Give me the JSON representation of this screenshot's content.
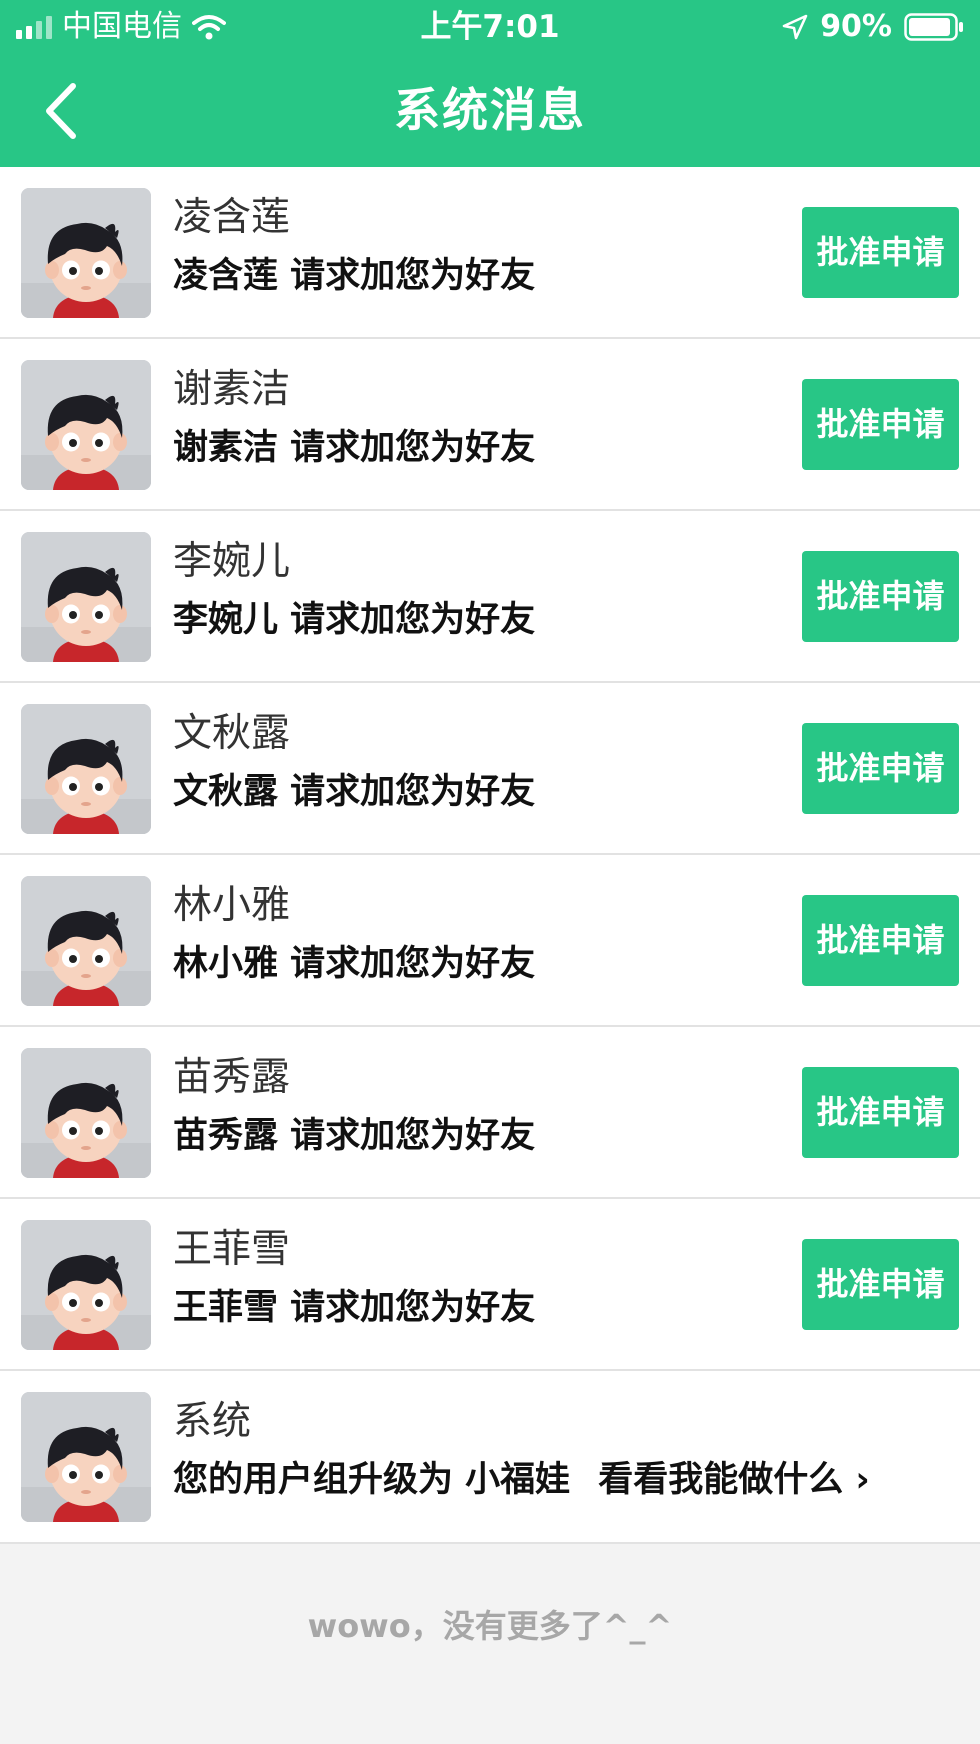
{
  "status_bar": {
    "carrier": "中国电信",
    "time": "上午7:01",
    "battery": "90%"
  },
  "nav": {
    "title": "系统消息",
    "back_icon": "chevron-left-icon"
  },
  "colors": {
    "accent": "#28c686",
    "divider": "#e2e2e2",
    "background": "#f3f3f3"
  },
  "messages": [
    {
      "name": "凌含莲",
      "text": "凌含莲 请求加您为好友",
      "action": "批准申请"
    },
    {
      "name": "谢素洁",
      "text": "谢素洁 请求加您为好友",
      "action": "批准申请"
    },
    {
      "name": "李婉儿",
      "text": "李婉儿 请求加您为好友",
      "action": "批准申请"
    },
    {
      "name": "文秋露",
      "text": "文秋露 请求加您为好友",
      "action": "批准申请"
    },
    {
      "name": "林小雅",
      "text": "林小雅 请求加您为好友",
      "action": "批准申请"
    },
    {
      "name": "苗秀露",
      "text": "苗秀露 请求加您为好友",
      "action": "批准申请"
    },
    {
      "name": "王菲雪",
      "text": "王菲雪 请求加您为好友",
      "action": "批准申请"
    }
  ],
  "system_message": {
    "name": "系统",
    "text": "您的用户组升级为 小福娃",
    "link": "看看我能做什么 ›"
  },
  "footer": "wowo，没有更多了^_^"
}
